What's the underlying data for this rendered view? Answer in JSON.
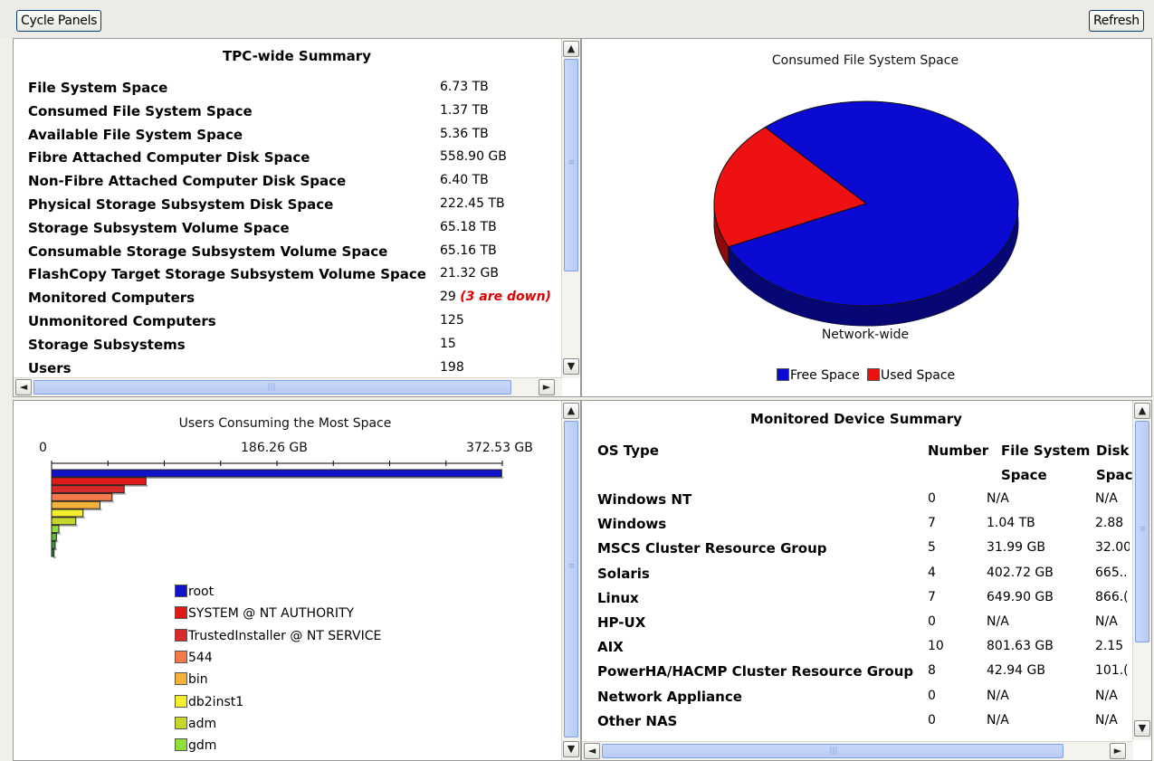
{
  "toolbar": {
    "cycle_label": "Cycle Panels",
    "refresh_label": "Refresh"
  },
  "summary": {
    "title": "TPC-wide Summary",
    "rows": [
      {
        "label": "File System Space",
        "value": "6.73 TB"
      },
      {
        "label": "Consumed File System Space",
        "value": "1.37 TB"
      },
      {
        "label": "Available File System Space",
        "value": "5.36 TB"
      },
      {
        "label": "Fibre Attached Computer Disk Space",
        "value": "558.90 GB"
      },
      {
        "label": "Non-Fibre Attached Computer Disk Space",
        "value": "6.40 TB"
      },
      {
        "label": "Physical Storage Subsystem Disk Space",
        "value": "222.45 TB"
      },
      {
        "label": "Storage Subsystem Volume Space",
        "value": "65.18 TB"
      },
      {
        "label": "Consumable Storage Subsystem Volume Space",
        "value": "65.16 TB"
      },
      {
        "label": "FlashCopy Target Storage Subsystem Volume Space",
        "value": "21.32 GB"
      },
      {
        "label": "Monitored Computers",
        "value": "29",
        "note": "(3 are down)"
      },
      {
        "label": "Unmonitored Computers",
        "value": "125"
      },
      {
        "label": "Storage Subsystems",
        "value": "15"
      },
      {
        "label": "Users",
        "value": "198"
      }
    ]
  },
  "consumed_chart": {
    "chart_data": {
      "type": "pie",
      "title": "Consumed File System Space",
      "xlabel": "Network-wide",
      "slices": [
        {
          "label": "Free Space",
          "value": 5.36,
          "color": "#0a0ad2"
        },
        {
          "label": "Used Space",
          "value": 1.37,
          "color": "#ee1111"
        }
      ],
      "legend": "bottom"
    }
  },
  "users_chart": {
    "chart_data": {
      "type": "bar",
      "title": "Users Consuming the Most Space",
      "ticks": [
        "0",
        "186.26 GB",
        "372.53 GB"
      ],
      "xlim": [
        0,
        372.53
      ],
      "categories": [
        "root",
        "SYSTEM @ NT AUTHORITY",
        "TrustedInstaller @ NT SERVICE",
        "544",
        "bin",
        "db2inst1",
        "adm",
        "gdm",
        "",
        "",
        ""
      ],
      "values": [
        372,
        78,
        60,
        50,
        40,
        26,
        20,
        6,
        4,
        3,
        2
      ],
      "colors": [
        "#1212c8",
        "#e11a1a",
        "#d82a2a",
        "#f47a4a",
        "#f4b23a",
        "#f4ee2e",
        "#c6d62a",
        "#8fe03a",
        "#5cc02e",
        "#3a9a3a",
        "#2f7a2f"
      ],
      "legend": "bottom"
    }
  },
  "devices": {
    "title": "Monitored Device Summary",
    "headers": {
      "os": "OS Type",
      "number": "Number",
      "fs1": "File System",
      "fs2": "Space",
      "disk1": "Disk",
      "disk2": "Space"
    },
    "rows": [
      {
        "os": "Windows NT",
        "number": "0",
        "fs": "N/A",
        "disk": "N/A"
      },
      {
        "os": "Windows",
        "number": "7",
        "fs": "1.04 TB",
        "disk": "2.88"
      },
      {
        "os": "MSCS Cluster Resource Group",
        "number": "5",
        "fs": "31.99 GB",
        "disk": "32.00"
      },
      {
        "os": "Solaris",
        "number": "4",
        "fs": "402.72 GB",
        "disk": "665.."
      },
      {
        "os": "Linux",
        "number": "7",
        "fs": "649.90 GB",
        "disk": "866.("
      },
      {
        "os": "HP-UX",
        "number": "0",
        "fs": "N/A",
        "disk": "N/A"
      },
      {
        "os": "AIX",
        "number": "10",
        "fs": "801.63 GB",
        "disk": "2.15"
      },
      {
        "os": "PowerHA/HACMP Cluster Resource Group",
        "number": "8",
        "fs": "42.94 GB",
        "disk": "101.("
      },
      {
        "os": "Network Appliance",
        "number": "0",
        "fs": "N/A",
        "disk": "N/A"
      },
      {
        "os": "Other NAS",
        "number": "0",
        "fs": "N/A",
        "disk": "N/A"
      }
    ]
  }
}
